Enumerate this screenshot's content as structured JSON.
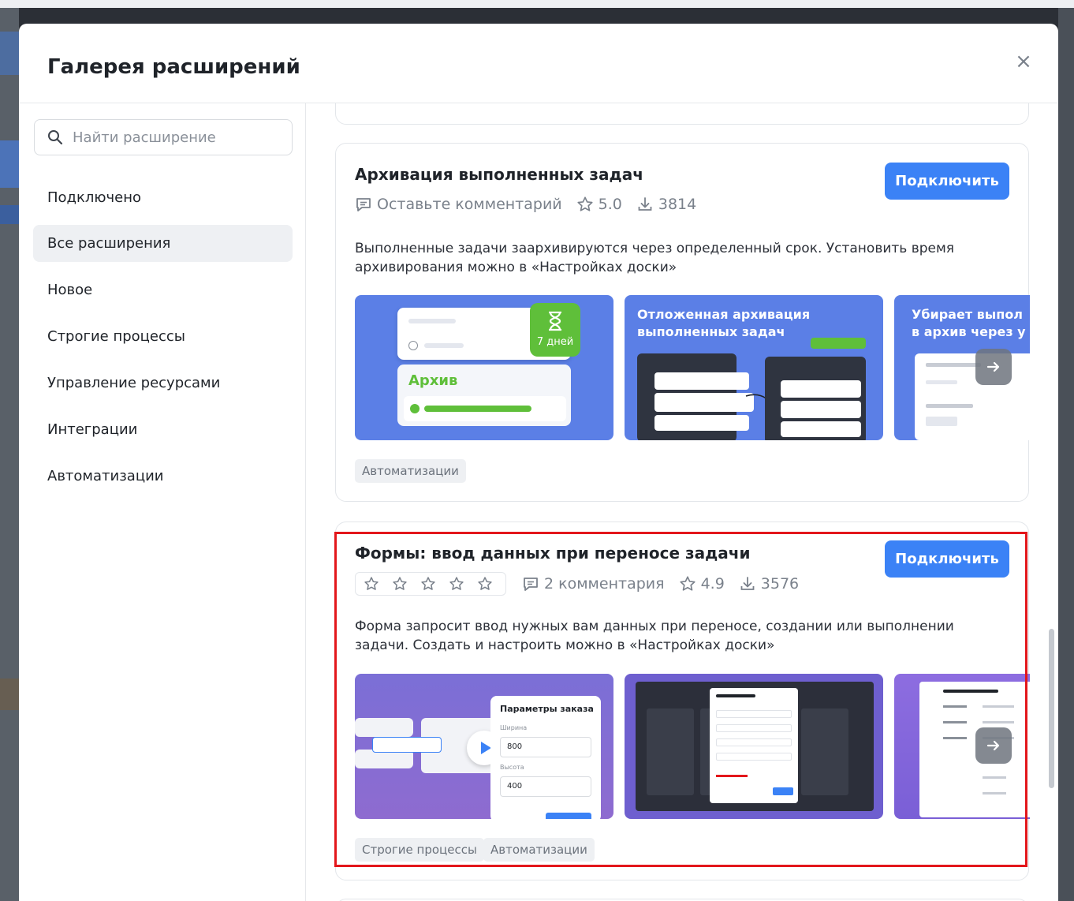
{
  "modal": {
    "title": "Галерея расширений",
    "close_label": "×"
  },
  "search": {
    "placeholder": "Найти расширение"
  },
  "sidebar": {
    "items": [
      {
        "label": "Подключено"
      },
      {
        "label": "Все расширения",
        "active": true
      },
      {
        "label": "Новое"
      },
      {
        "label": "Строгие процессы"
      },
      {
        "label": "Управление ресурсами"
      },
      {
        "label": "Интеграции"
      },
      {
        "label": "Автоматизации"
      }
    ]
  },
  "cards": [
    {
      "title": "Архивация выполненных задач",
      "connect_label": "Подключить",
      "comments": "Оставьте комментарий",
      "rating": "5.0",
      "downloads": "3814",
      "description": "Выполненные задачи заархивируются через определенный срок. Установить время архивирования можно в «Настройках доски»",
      "screenshots": {
        "s1": {
          "timer": "7 дней",
          "archive_label": "Архив"
        },
        "s2": {
          "title": "Отложенная архивация выполненных задач"
        },
        "s3": {
          "title": "Убирает выпол в архив через у"
        }
      },
      "tags": [
        "Автоматизации"
      ]
    },
    {
      "title": "Формы: ввод данных при переносе задачи",
      "connect_label": "Подключить",
      "user_rating_stars": 5,
      "comments": "2 комментария",
      "rating": "4.9",
      "downloads": "3576",
      "description": "Форма запросит ввод нужных вам данных при переносе, создании или выполнении задачи. Создать и настроить можно в «Настройках доски»",
      "screenshots": {
        "s1": {
          "form_title": "Параметры заказа",
          "width_label": "Ширина",
          "width_value": "800",
          "height_label": "Высота",
          "height_value": "400"
        }
      },
      "tags": [
        "Строгие процессы",
        "Автоматизации"
      ]
    }
  ],
  "colors": {
    "accent": "#3b82f6",
    "highlight": "#e3161b",
    "green": "#5fbf3a",
    "shot_blue": "#5b7fe6",
    "shot_purple": "#7b6fd6"
  }
}
